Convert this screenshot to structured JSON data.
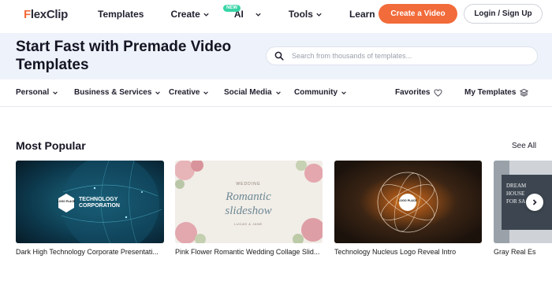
{
  "brand": {
    "name_prefix": "F",
    "name_rest": "lexClip",
    "accent": "#f26b3a"
  },
  "nav": {
    "items": [
      {
        "label": "Templates",
        "has_chevron": false
      },
      {
        "label": "Create",
        "has_chevron": true
      },
      {
        "label": "AI",
        "has_chevron": true,
        "badge": "NEW"
      },
      {
        "label": "Tools",
        "has_chevron": true
      },
      {
        "label": "Learn",
        "has_chevron": true
      }
    ],
    "create_button": "Create a Video",
    "login_button": "Login / Sign Up"
  },
  "hero": {
    "title": "Start Fast with Premade Video Templates",
    "search_placeholder": "Search from thousands of templates..."
  },
  "categories": [
    {
      "label": "Personal",
      "icon": "chevron-down-icon"
    },
    {
      "label": "Business & Services",
      "icon": "chevron-down-icon"
    },
    {
      "label": "Creative",
      "icon": "chevron-down-icon"
    },
    {
      "label": "Social Media",
      "icon": "chevron-down-icon"
    },
    {
      "label": "Community",
      "icon": "chevron-down-icon"
    }
  ],
  "favorites": {
    "label": "Favorites",
    "icon": "heart-icon"
  },
  "my_templates": {
    "label": "My Templates",
    "icon": "stack-icon"
  },
  "popular": {
    "title": "Most Popular",
    "see_all": "See All",
    "cards": [
      {
        "title": "Dark High Technology Corporate Presentati...",
        "thumb_logo": "LOGO PLACE",
        "thumb_text_1": "TECHNOLOGY",
        "thumb_text_2": "CORPORATION"
      },
      {
        "title": "Pink Flower Romantic Wedding Collage Slid...",
        "thumb_small": "WEDDING",
        "thumb_script_1": "Romantic",
        "thumb_script_2": "slideshow",
        "thumb_names": "LUCAS & JANE"
      },
      {
        "title": "Technology Nucleus Logo Reveal Intro",
        "thumb_logo": "LOGO PLACE"
      },
      {
        "title": "Gray Real Es",
        "thumb_text_1": "DREAM",
        "thumb_text_2": "HOUSE",
        "thumb_text_3": "FOR SA"
      }
    ]
  }
}
